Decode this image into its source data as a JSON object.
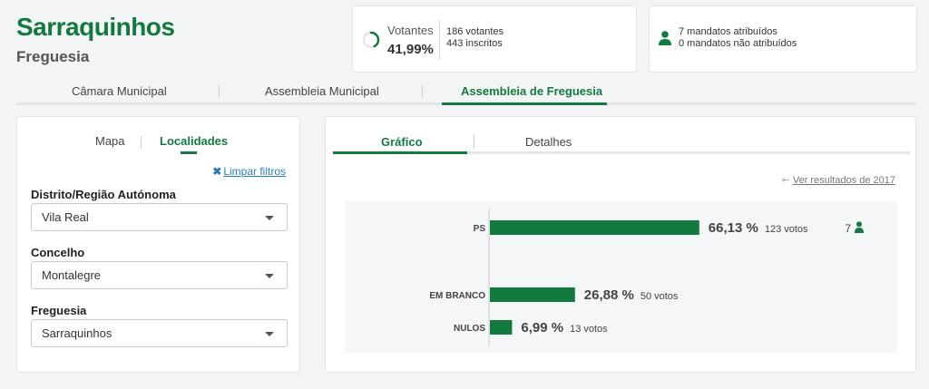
{
  "header": {
    "title": "Sarraquinhos",
    "subtitle": "Freguesia"
  },
  "votantes": {
    "label": "Votantes",
    "percent": "41,99%",
    "percent_value": 41.99,
    "voters": "186 votantes",
    "registered": "443 inscritos"
  },
  "mandatos": {
    "assigned": "7 mandatos atribuídos",
    "unassigned": "0 mandatos não atribuídos"
  },
  "main_tabs": [
    "Câmara Municipal",
    "Assembleia Municipal",
    "Assembleia de Freguesia"
  ],
  "left_panel": {
    "tabs": [
      "Mapa",
      "Localidades"
    ],
    "clear_filters": "Limpar filtros",
    "fields": [
      {
        "label": "Distrito/Região Autónoma",
        "value": "Vila Real"
      },
      {
        "label": "Concelho",
        "value": "Montalegre"
      },
      {
        "label": "Freguesia",
        "value": "Sarraquinhos"
      }
    ]
  },
  "right_panel": {
    "tabs": [
      "Gráfico",
      "Detalhes"
    ],
    "prev_results": "Ver resultados de 2017"
  },
  "chart_data": {
    "type": "bar",
    "orientation": "horizontal",
    "categories": [
      "PS",
      "EM BRANCO",
      "NULOS"
    ],
    "values": [
      66.13,
      26.88,
      6.99
    ],
    "value_labels": [
      "66,13 %",
      "26,88 %",
      "6,99 %"
    ],
    "vote_labels": [
      "123 votos",
      "50 votos",
      "13 votos"
    ],
    "seats": [
      "7",
      "",
      ""
    ],
    "xlim": [
      0,
      100
    ],
    "color": "#127a3f"
  }
}
